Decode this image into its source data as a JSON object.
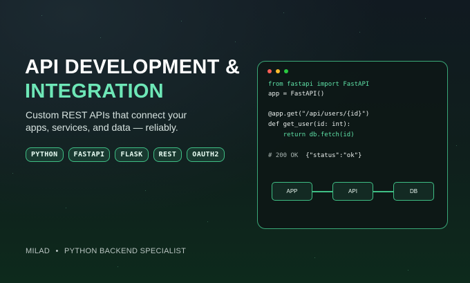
{
  "hero": {
    "title_line1": "API DEVELOPMENT &",
    "title_line2": "INTEGRATION",
    "subtitle_line1": "Custom REST APIs that connect your",
    "subtitle_line2": "apps, services, and data — reliably."
  },
  "tags": [
    "PYTHON",
    "FASTAPI",
    "FLASK",
    "REST",
    "OAUTH2"
  ],
  "code": {
    "line1_kw": "from fastapi import FastAPI",
    "line2": "app = FastAPI()",
    "line3": "@app.get(\"/api/users/{id}\")",
    "line4": "def get_user(id: int):",
    "line5_indent": "    ",
    "line5_kw": "return db.fetch(id)",
    "line6_comment": "# 200 OK",
    "line6_rest": "  {\"status\":\"ok\"}"
  },
  "diagram": {
    "nodes": [
      "APP",
      "API",
      "DB"
    ]
  },
  "footer": {
    "name": "MILAD",
    "separator": "•",
    "role": "PYTHON BACKEND SPECIALIST"
  },
  "colors": {
    "accent": "#6ee7b7",
    "border": "#3fbf85",
    "dot_red": "#ff5f57",
    "dot_yellow": "#febc2e",
    "dot_green": "#28c840"
  }
}
